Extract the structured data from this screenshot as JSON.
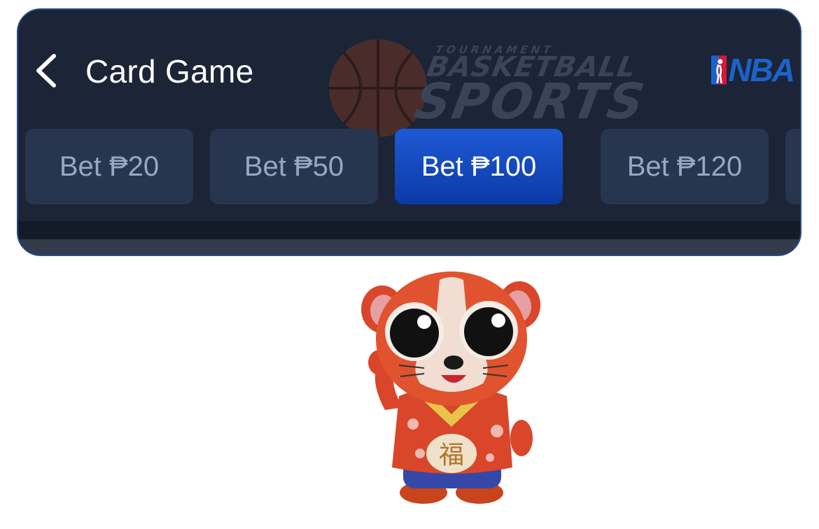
{
  "header": {
    "title": "Card Game",
    "back_icon": "chevron-left-icon",
    "banner": {
      "line1": "TOURNAMENT",
      "line2": "BASKETBALL",
      "line3": "SPORTS"
    },
    "league_logo": {
      "text": "NBA",
      "colors": {
        "red": "#d6183b",
        "blue": "#1c63c9"
      }
    }
  },
  "bets": {
    "selected_index": 2,
    "options": [
      {
        "label": "Bet ₱20"
      },
      {
        "label": "Bet ₱50"
      },
      {
        "label": "Bet ₱100"
      },
      {
        "label": "Bet ₱120"
      }
    ]
  },
  "colors": {
    "panel_bg": "#1b2537",
    "chip_bg": "#28354e",
    "chip_active": "#1f5ad6",
    "chip_text": "#97a7c5"
  },
  "mascot": {
    "badge_text": "福"
  }
}
